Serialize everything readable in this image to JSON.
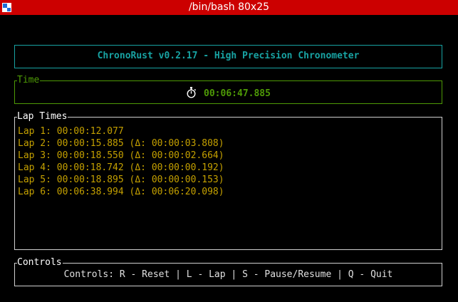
{
  "window": {
    "title": "/bin/bash 80x25",
    "accent_color": "#cc0000"
  },
  "header": {
    "title": "ChronoRust v0.2.17 - High Precision Chronometer",
    "color": "#18a3a3"
  },
  "time_panel": {
    "label": "Time",
    "icon": "stopwatch-icon",
    "elapsed": "00:06:47.885",
    "color": "#4e9a06"
  },
  "laps_panel": {
    "label": "Lap Times",
    "color": "#c4a000",
    "laps": [
      "Lap 1: 00:00:12.077",
      "Lap 2: 00:00:15.885 (Δ: 00:00:03.808)",
      "Lap 3: 00:00:18.550 (Δ: 00:00:02.664)",
      "Lap 4: 00:00:18.742 (Δ: 00:00:00.192)",
      "Lap 5: 00:00:18.895 (Δ: 00:00:00.153)",
      "Lap 6: 00:06:38.994 (Δ: 00:06:20.098)"
    ]
  },
  "controls_panel": {
    "label": "Controls",
    "text": "Controls: R - Reset | L - Lap | S - Pause/Resume | Q - Quit"
  }
}
